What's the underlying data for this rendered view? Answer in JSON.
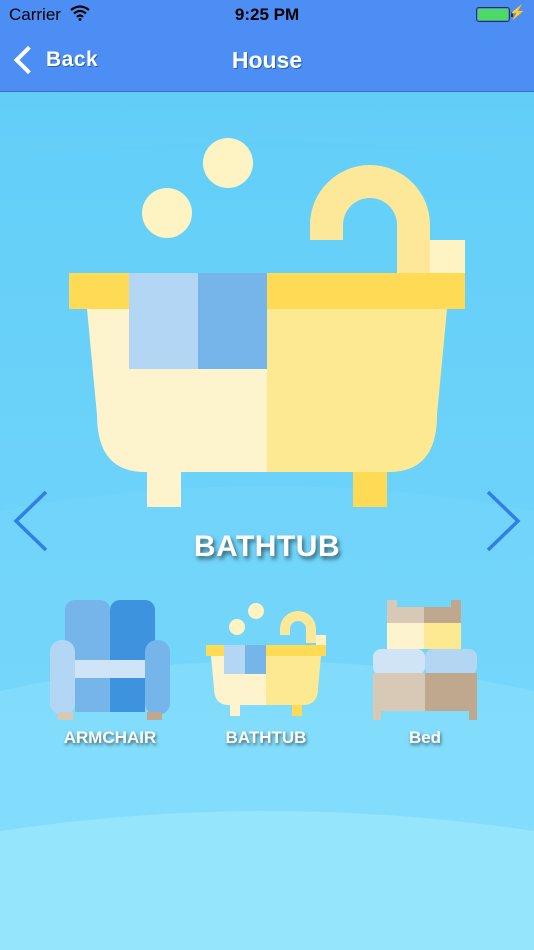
{
  "status_bar": {
    "carrier": "Carrier",
    "time": "9:25 PM",
    "battery_level": 1.0
  },
  "nav": {
    "back_label": "Back",
    "title": "House"
  },
  "selected_item": {
    "name": "BATHTUB",
    "icon": "bathtub-icon"
  },
  "thumbnails": [
    {
      "label": "ARMCHAIR",
      "icon": "armchair-icon"
    },
    {
      "label": "BATHTUB",
      "icon": "bathtub-icon"
    },
    {
      "label": "Bed",
      "icon": "bed-icon"
    }
  ],
  "icons": {
    "prev": "chevron-left-icon",
    "next": "chevron-right-icon"
  },
  "colors": {
    "nav_bar": "#4c8ef4",
    "background_top": "#5bcbf7",
    "background_bottom": "#a6ecfe",
    "arrow": "#2f7fe6"
  }
}
